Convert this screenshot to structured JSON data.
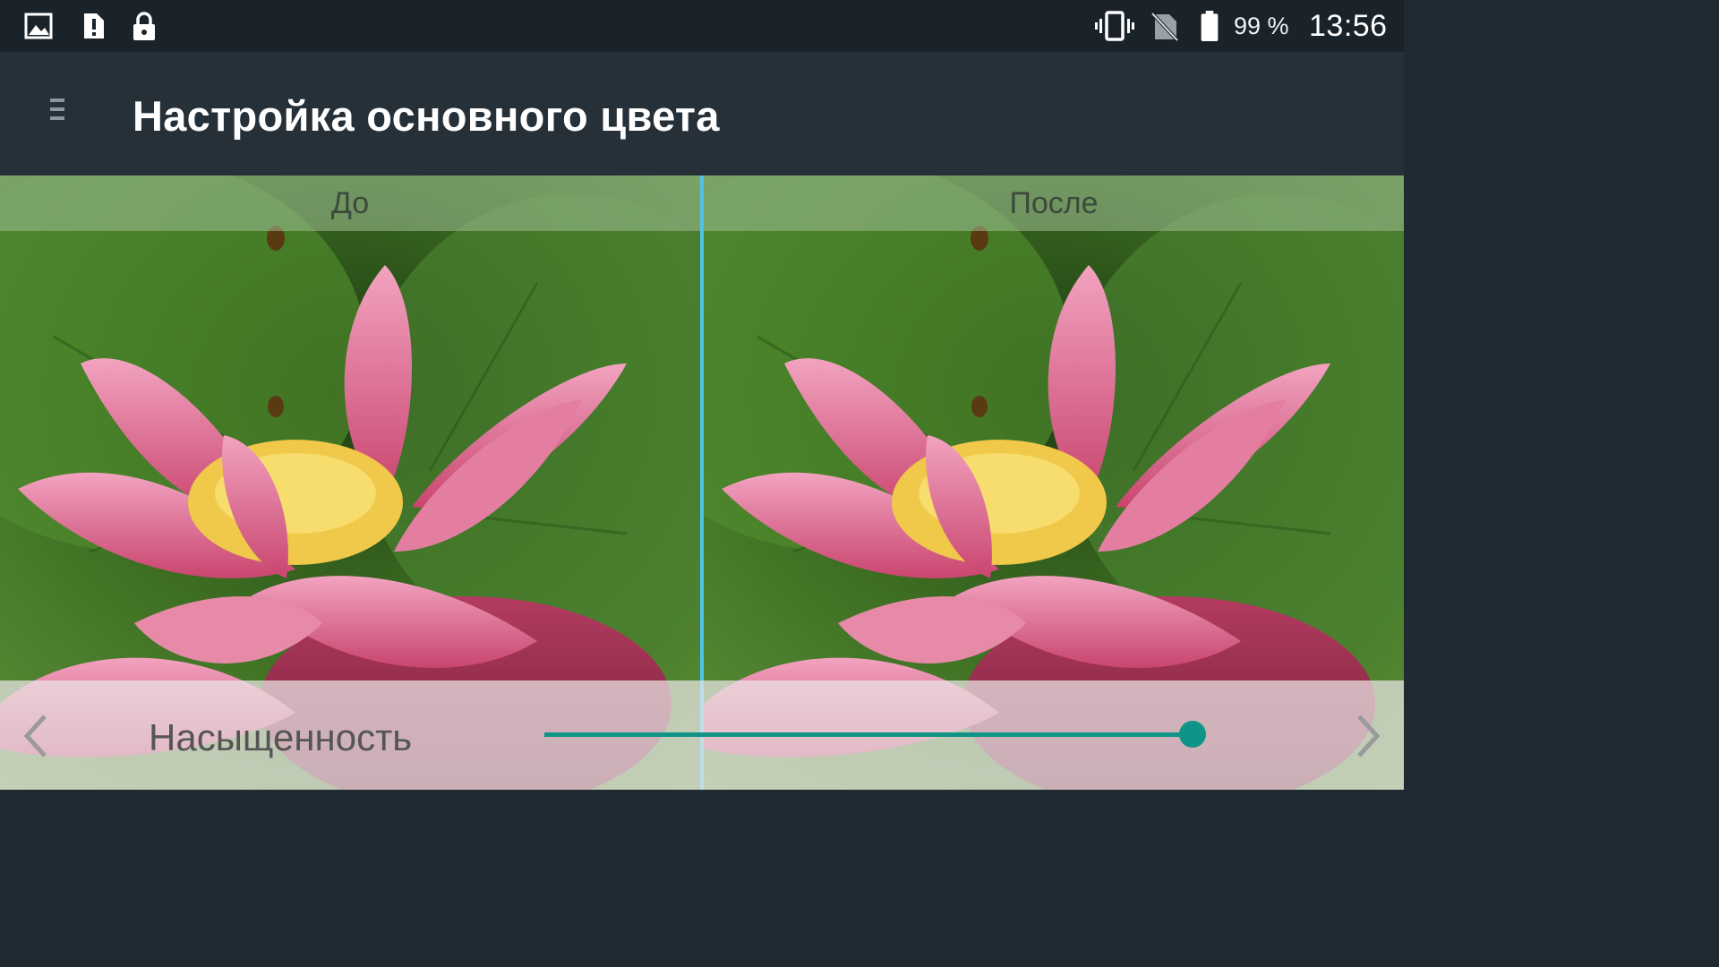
{
  "status_bar": {
    "battery_percent": "99 %",
    "time": "13:56",
    "icons": [
      "gallery-icon",
      "alert-icon",
      "lock-icon",
      "vibrate-icon",
      "no-sim-icon",
      "battery-icon"
    ]
  },
  "app_bar": {
    "title": "Настройка основного цвета",
    "menu_icon": "menu-icon"
  },
  "comparison": {
    "before_label": "До",
    "after_label": "После"
  },
  "controls": {
    "setting_label": "Насыщенность",
    "slider_value": 1.0,
    "prev_icon": "chevron-left-icon",
    "next_icon": "chevron-right-icon"
  },
  "colors": {
    "accent": "#119488",
    "divider": "#4fc3e8",
    "app_bar": "#253039",
    "status_bar": "#1b232a"
  }
}
